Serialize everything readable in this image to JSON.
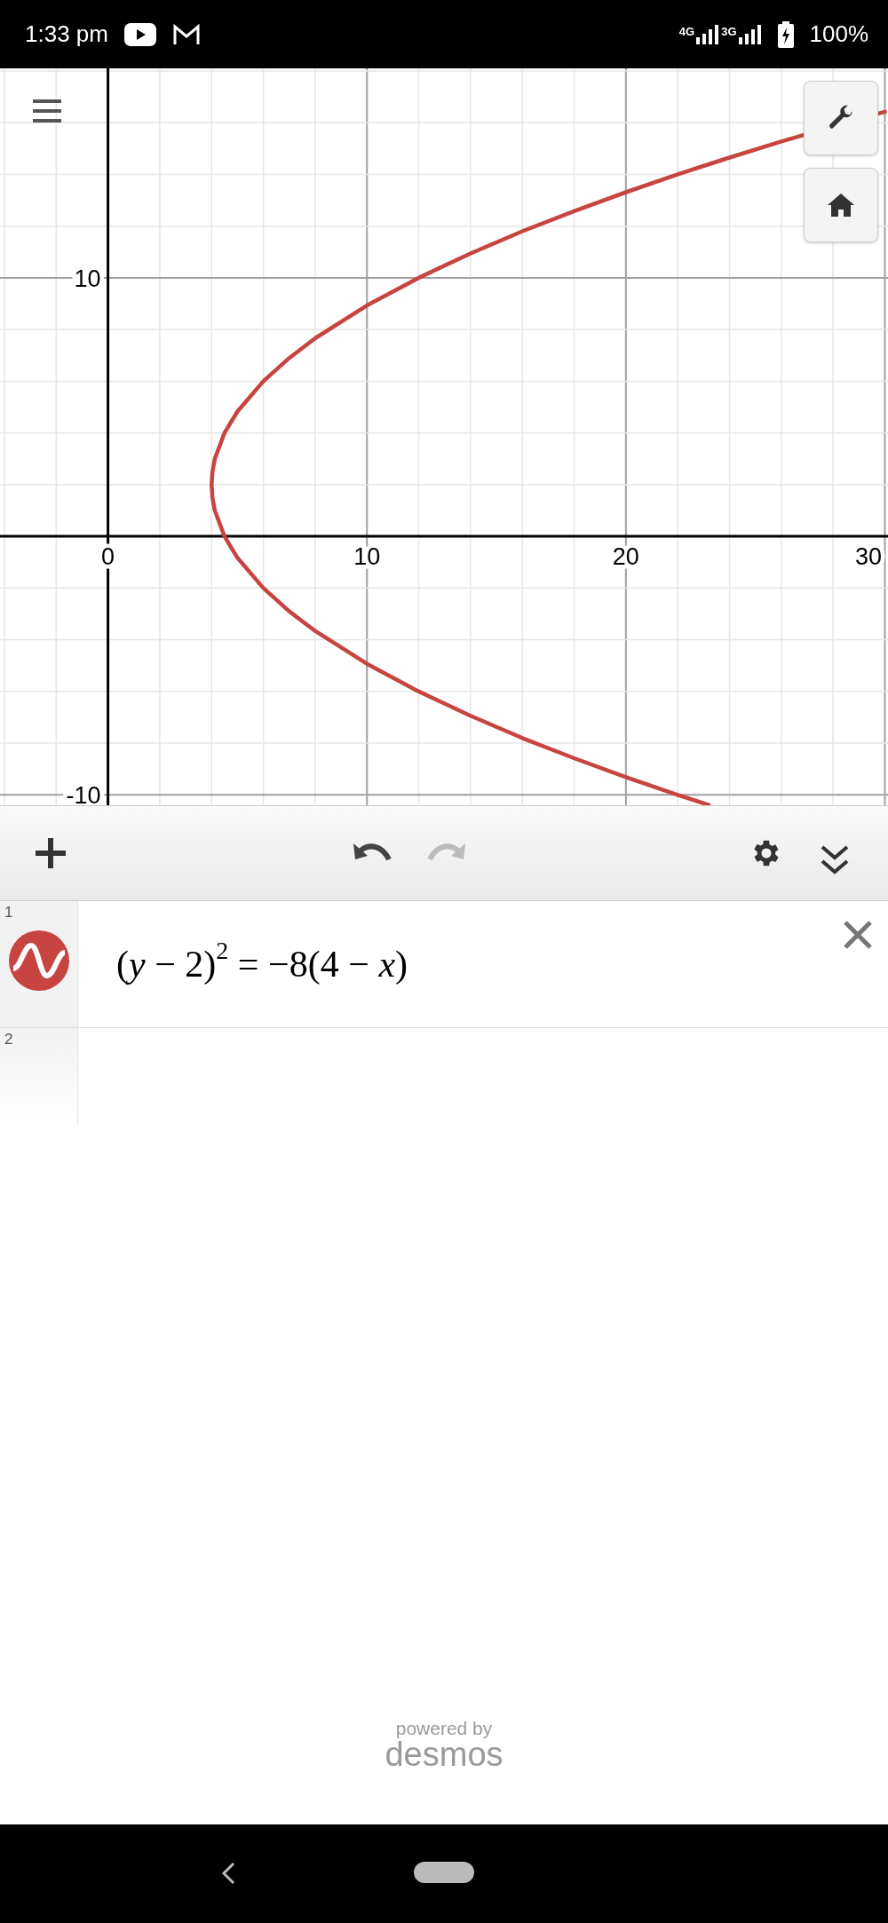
{
  "status_bar": {
    "time": "1:33 pm",
    "network_labels": [
      "4G",
      "3G"
    ],
    "battery": "100%"
  },
  "graph": {
    "chart_data": {
      "type": "line",
      "grid": true,
      "x": [
        30,
        26,
        24,
        23.2,
        22,
        20,
        18,
        16,
        14,
        12,
        10,
        8,
        7,
        6,
        5,
        4.5,
        4.125,
        4.03125,
        4,
        4.03125,
        4.125,
        4.5,
        5,
        6,
        7,
        8,
        10,
        12,
        14,
        16,
        18,
        20,
        22,
        23.2
      ],
      "xlim": [
        -4.17,
        30.12
      ],
      "ylim": [
        -10.4,
        18.1
      ],
      "xticks": [
        0,
        10,
        20,
        30
      ],
      "yticks": [
        -10,
        10
      ],
      "series": [
        {
          "color": "#c74440",
          "values": [
            16.42,
            15.27,
            14.65,
            14.39,
            14,
            13.31,
            12.58,
            11.8,
            10.94,
            10,
            8.93,
            7.66,
            6.9,
            6,
            4.83,
            4,
            3,
            2.5,
            2,
            1.5,
            1,
            0,
            -0.83,
            -2,
            -2.9,
            -3.66,
            -4.93,
            -6,
            -6.94,
            -7.8,
            -8.58,
            -9.31,
            -10,
            -10.39
          ]
        }
      ]
    }
  },
  "toolbar": {
    "undo_disabled": false,
    "redo_disabled": true
  },
  "expressions": [
    {
      "kind": "equation",
      "number": "1",
      "color": "#c74440",
      "text": "(*y* − 2)$^{2}$ = −8(4 − *x*)"
    },
    {
      "kind": "empty",
      "number": "2"
    }
  ],
  "footer": {
    "caption": "powered by",
    "brand": "desmos"
  }
}
